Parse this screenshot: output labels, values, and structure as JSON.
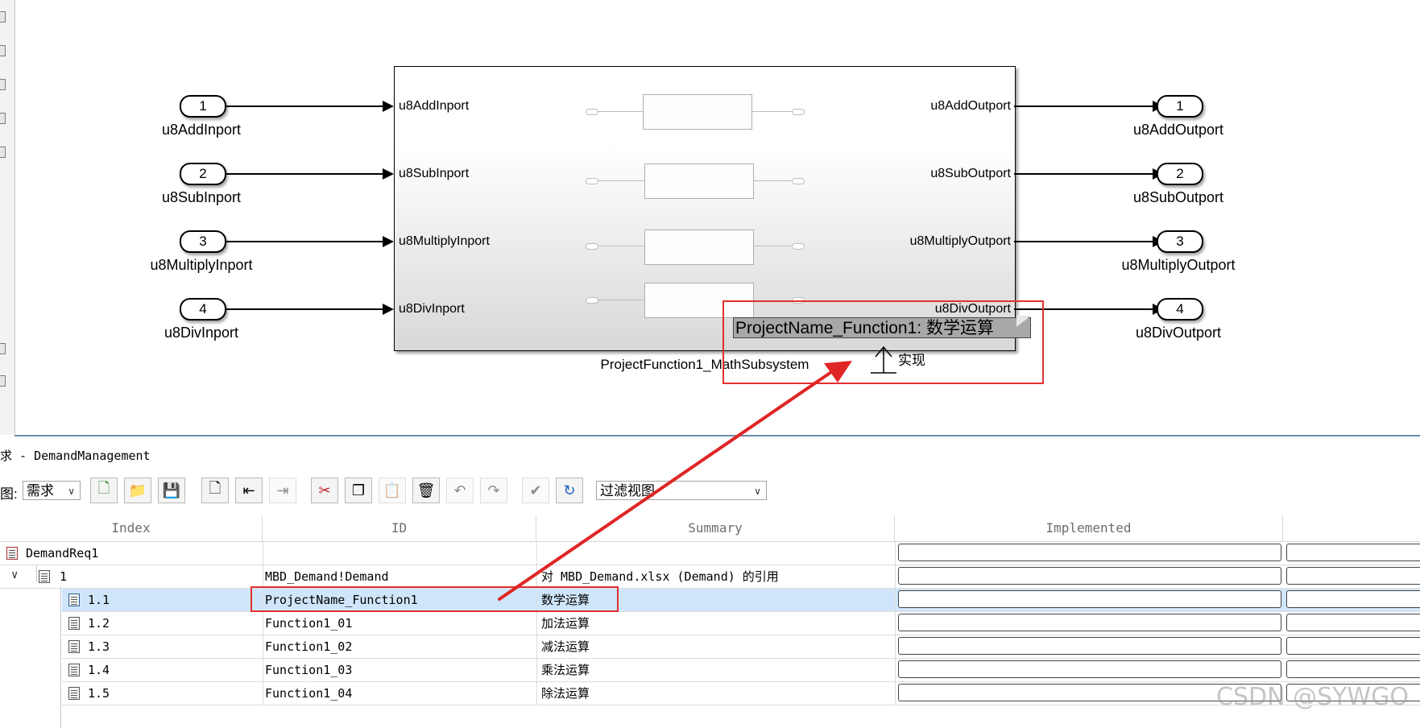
{
  "model": {
    "subsystem_name": "ProjectFunction1_MathSubsystem",
    "inports": [
      {
        "num": "1",
        "name": "u8AddInport"
      },
      {
        "num": "2",
        "name": "u8SubInport"
      },
      {
        "num": "3",
        "name": "u8MultiplyInport"
      },
      {
        "num": "4",
        "name": "u8DivInport"
      }
    ],
    "outports": [
      {
        "num": "1",
        "name": "u8AddOutport"
      },
      {
        "num": "2",
        "name": "u8SubOutport"
      },
      {
        "num": "3",
        "name": "u8MultiplyOutport"
      },
      {
        "num": "4",
        "name": "u8DivOutport"
      }
    ],
    "requirement_tag": "ProjectName_Function1: 数学运算",
    "link_label": "实现"
  },
  "req_panel": {
    "title": "求 - DemandManagement",
    "view_label": "图:",
    "view_value": "需求",
    "filter_value": "过滤视图",
    "columns": [
      "Index",
      "ID",
      "Summary",
      "Implemented"
    ],
    "rows": [
      {
        "index": "DemandReq1",
        "id": "",
        "summary": ""
      },
      {
        "index": "1",
        "id": "MBD_Demand!Demand",
        "summary": "对 MBD_Demand.xlsx (Demand) 的引用"
      },
      {
        "index": "1.1",
        "id": "ProjectName_Function1",
        "summary": "数学运算"
      },
      {
        "index": "1.2",
        "id": "Function1_01",
        "summary": "加法运算"
      },
      {
        "index": "1.3",
        "id": "Function1_02",
        "summary": "减法运算"
      },
      {
        "index": "1.4",
        "id": "Function1_03",
        "summary": "乘法运算"
      },
      {
        "index": "1.5",
        "id": "Function1_04",
        "summary": "除法运算"
      }
    ]
  },
  "watermark": "CSDN @SYWGO",
  "colors": {
    "highlight_red": "#e03030",
    "selection": "#cfe6fa"
  }
}
